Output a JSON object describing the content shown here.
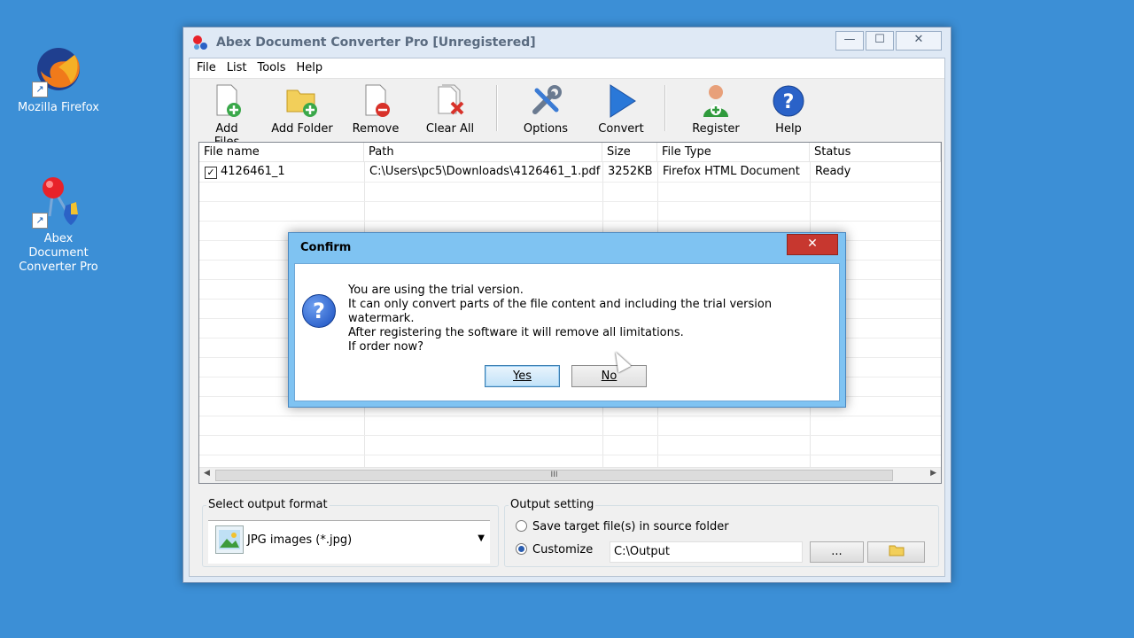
{
  "desktop": {
    "icons": [
      {
        "label": "Mozilla Firefox"
      },
      {
        "label_line1": "Abex Document",
        "label_line2": "Converter Pro"
      }
    ]
  },
  "window": {
    "title": "Abex Document Converter Pro [Unregistered]",
    "controls": {
      "minimize": "—",
      "maximize": "☐",
      "close": "✕"
    }
  },
  "menu": [
    "File",
    "List",
    "Tools",
    "Help"
  ],
  "toolbar": {
    "add_files": "Add Files",
    "add_folder": "Add Folder",
    "remove": "Remove",
    "clear_all": "Clear All",
    "options": "Options",
    "convert": "Convert",
    "register": "Register",
    "help": "Help"
  },
  "table": {
    "columns": [
      "File name",
      "Path",
      "Size",
      "File Type",
      "Status"
    ],
    "rows": [
      {
        "checked": true,
        "file_name": "4126461_1",
        "path": "C:\\Users\\pc5\\Downloads\\4126461_1.pdf",
        "size": "3252KB",
        "file_type": "Firefox HTML Document",
        "status": "Ready"
      }
    ],
    "scroll_thumb_glyph": "III"
  },
  "output_format": {
    "group_title": "Select output format",
    "selected": "JPG images (*.jpg)"
  },
  "output_setting": {
    "group_title": "Output setting",
    "option_source": "Save target file(s) in source folder",
    "option_customize": "Customize",
    "customize_selected": true,
    "path": "C:\\Output",
    "browse_label": "...",
    "folder_icon": "folder-icon"
  },
  "dialog": {
    "title": "Confirm",
    "close_glyph": "✕",
    "icon": "question-icon",
    "lines": [
      "You are using the trial version.",
      "It can only convert parts of the file content and including the trial version watermark.",
      "After registering the software it will remove all limitations.",
      "If order now?"
    ],
    "yes_label": "Yes",
    "no_label": "No"
  },
  "colors": {
    "desktop": "#3c8fd6",
    "dialog_frame": "#7fc3f2",
    "close_button": "#c7372f"
  }
}
